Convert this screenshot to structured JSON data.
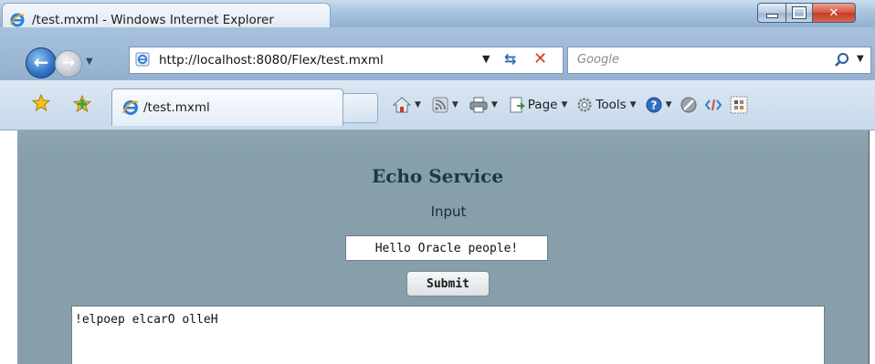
{
  "window": {
    "title": "/test.mxml - Windows Internet Explorer"
  },
  "address_bar": {
    "url": "http://localhost:8080/Flex/test.mxml"
  },
  "search": {
    "placeholder": "Google"
  },
  "tabs": [
    {
      "label": "/test.mxml"
    }
  ],
  "command_bar": {
    "page_label": "Page",
    "tools_label": "Tools"
  },
  "app": {
    "title": "Echo Service",
    "input_label": "Input",
    "input_value": "Hello Oracle people!",
    "submit_label": "Submit",
    "output_text": "!elpoep elcarO olleH"
  },
  "colors": {
    "content_background": "#869fab",
    "title_color": "#193a44"
  }
}
